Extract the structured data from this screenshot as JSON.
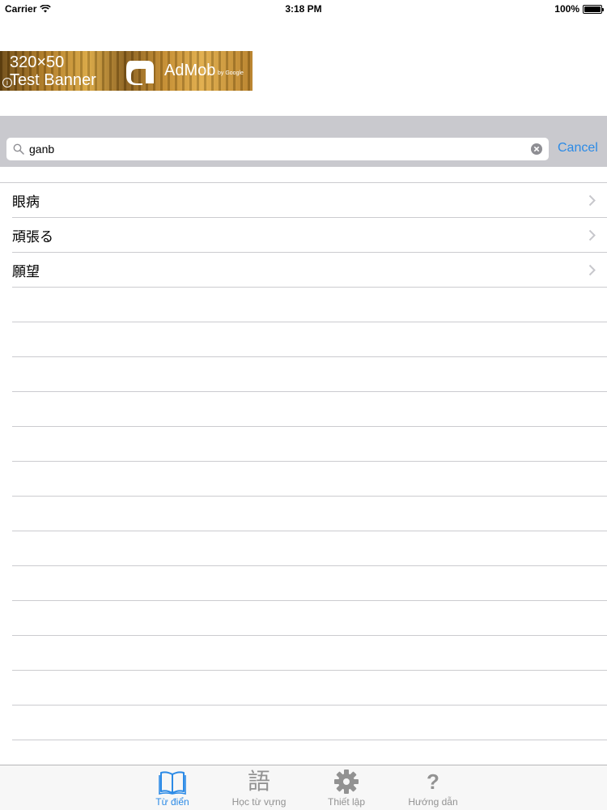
{
  "status_bar": {
    "carrier": "Carrier",
    "time": "3:18 PM",
    "battery": "100%"
  },
  "ad": {
    "size_text": "320×50",
    "test_text": "Test Banner",
    "brand": "AdMob",
    "brand_sub": "by Google"
  },
  "search": {
    "value": "ganb",
    "cancel_label": "Cancel"
  },
  "results": [
    {
      "label": "眼病"
    },
    {
      "label": "頑張る"
    },
    {
      "label": "願望"
    }
  ],
  "tabs": [
    {
      "label": "Từ điển",
      "icon": "book-icon",
      "active": true
    },
    {
      "label": "Học từ vựng",
      "icon": "kanji-icon",
      "glyph": "語",
      "active": false
    },
    {
      "label": "Thiết lập",
      "icon": "gear-icon",
      "active": false
    },
    {
      "label": "Hướng dẫn",
      "icon": "help-icon",
      "glyph": "?",
      "active": false
    }
  ],
  "colors": {
    "accent": "#2b8ae6",
    "search_bar_bg": "#c9c9ce",
    "separator": "#cbcbcf",
    "tab_inactive": "#929292"
  }
}
